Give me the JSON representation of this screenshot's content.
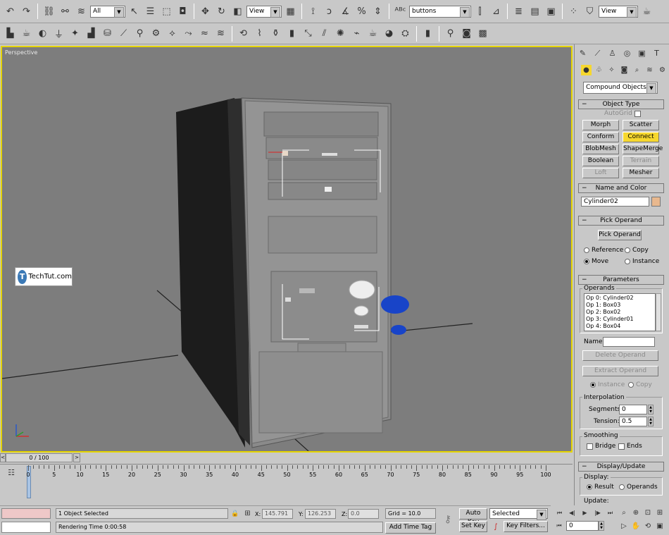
{
  "toolbar1": {
    "selection_filter": "All",
    "ref_coord": "View",
    "named_sel": "buttons",
    "view_dropdown": "View"
  },
  "viewport": {
    "label": "Perspective",
    "logo_text": "TechTut.com"
  },
  "panel": {
    "category": "Compound Objects",
    "object_type": {
      "title": "Object Type",
      "autogrid": "AutoGrid",
      "buttons": [
        "Morph",
        "Scatter",
        "Conform",
        "Connect",
        "BlobMesh",
        "ShapeMerge",
        "Boolean",
        "Terrain",
        "Loft",
        "Mesher"
      ]
    },
    "name_color": {
      "title": "Name and Color",
      "name": "Cylinder02",
      "color": "#e8b88e"
    },
    "pick_operand": {
      "title": "Pick Operand",
      "button": "Pick Operand",
      "reference": "Reference",
      "copy": "Copy",
      "move": "Move",
      "instance": "Instance"
    },
    "parameters": {
      "title": "Parameters",
      "operands_label": "Operands",
      "operands": [
        "Op 0: Cylinder02",
        "Op 1: Box03",
        "Op 2: Box02",
        "Op 3: Cylinder01",
        "Op 4: Box04"
      ],
      "name_label": "Name:",
      "delete_operand": "Delete Operand",
      "extract_operand": "Extract Operand",
      "instance": "Instance",
      "copy": "Copy",
      "interpolation": "Interpolation",
      "segments_label": "Segments:",
      "segments": "0",
      "tension_label": "Tension:",
      "tension": "0.5",
      "smoothing": "Smoothing",
      "bridge": "Bridge",
      "ends": "Ends"
    },
    "display_update": {
      "title": "Display/Update",
      "display": "Display:",
      "result": "Result",
      "operands": "Operands",
      "update": "Update:"
    }
  },
  "timeline": {
    "frame": "0 / 100",
    "ticks": [
      "0",
      "5",
      "10",
      "15",
      "20",
      "25",
      "30",
      "35",
      "40",
      "45",
      "50",
      "55",
      "60",
      "65",
      "70",
      "75",
      "80",
      "85",
      "90",
      "95",
      "100"
    ]
  },
  "status": {
    "selected": "1 Object Selected",
    "rendering": "Rendering Time  0:00:58",
    "x_label": "X:",
    "x": "145.791",
    "y_label": "Y:",
    "y": "126.253",
    "z_label": "Z:",
    "z": "0.0",
    "grid": "Grid = 10.0",
    "add_time_tag": "Add Time Tag",
    "auto_key": "Auto Key",
    "set_key": "Set Key",
    "selected_mode": "Selected",
    "key_filters": "Key Filters...",
    "current_frame": "0"
  }
}
